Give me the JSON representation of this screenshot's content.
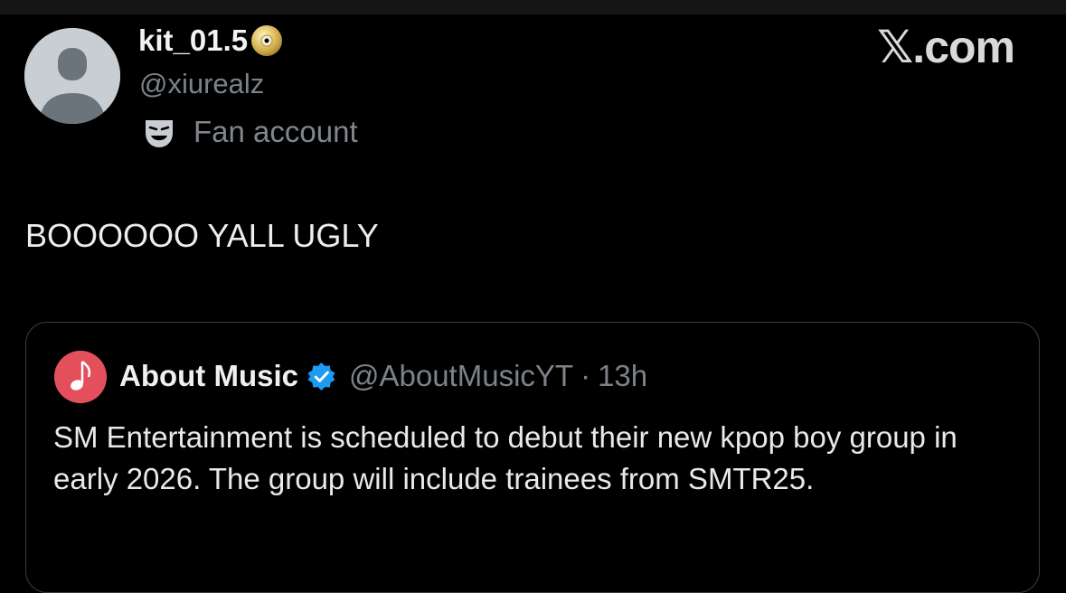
{
  "author": {
    "display_name": "kit_01.5",
    "name_emoji": "cd-icon",
    "handle": "@xiurealz",
    "avatar": "default-avatar",
    "badge_icon": "theater-mask-icon",
    "badge_label": "Fan account"
  },
  "brand": {
    "label": "𝕏.com"
  },
  "post": {
    "text": "BOOOOOO YALL UGLY"
  },
  "quoted_post": {
    "avatar_icon": "music-note-icon",
    "display_name": "About Music",
    "verified_icon": "verified-badge-icon",
    "handle": "@AboutMusicYT",
    "separator": "·",
    "time": "13h",
    "text": "SM Entertainment is scheduled to debut their new kpop boy group in early 2026. The group will include trainees from SMTR25."
  },
  "colors": {
    "background": "#000000",
    "text_primary": "#e7e9ea",
    "text_secondary": "#7c8289",
    "verified_blue": "#1d9bf0",
    "quote_avatar_bg": "#e3505c"
  }
}
